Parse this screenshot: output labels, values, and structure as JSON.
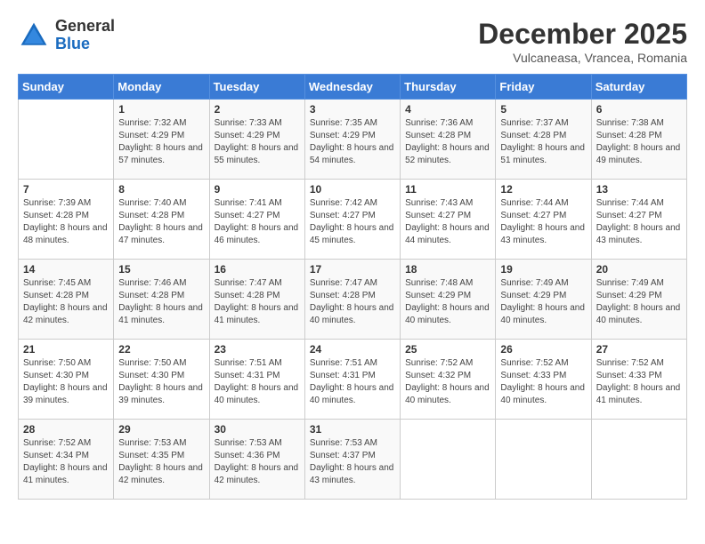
{
  "logo": {
    "general": "General",
    "blue": "Blue"
  },
  "title": "December 2025",
  "subtitle": "Vulcaneasa, Vrancea, Romania",
  "days_of_week": [
    "Sunday",
    "Monday",
    "Tuesday",
    "Wednesday",
    "Thursday",
    "Friday",
    "Saturday"
  ],
  "weeks": [
    [
      {
        "day": "",
        "sunrise": "",
        "sunset": "",
        "daylight": ""
      },
      {
        "day": "1",
        "sunrise": "Sunrise: 7:32 AM",
        "sunset": "Sunset: 4:29 PM",
        "daylight": "Daylight: 8 hours and 57 minutes."
      },
      {
        "day": "2",
        "sunrise": "Sunrise: 7:33 AM",
        "sunset": "Sunset: 4:29 PM",
        "daylight": "Daylight: 8 hours and 55 minutes."
      },
      {
        "day": "3",
        "sunrise": "Sunrise: 7:35 AM",
        "sunset": "Sunset: 4:29 PM",
        "daylight": "Daylight: 8 hours and 54 minutes."
      },
      {
        "day": "4",
        "sunrise": "Sunrise: 7:36 AM",
        "sunset": "Sunset: 4:28 PM",
        "daylight": "Daylight: 8 hours and 52 minutes."
      },
      {
        "day": "5",
        "sunrise": "Sunrise: 7:37 AM",
        "sunset": "Sunset: 4:28 PM",
        "daylight": "Daylight: 8 hours and 51 minutes."
      },
      {
        "day": "6",
        "sunrise": "Sunrise: 7:38 AM",
        "sunset": "Sunset: 4:28 PM",
        "daylight": "Daylight: 8 hours and 49 minutes."
      }
    ],
    [
      {
        "day": "7",
        "sunrise": "Sunrise: 7:39 AM",
        "sunset": "Sunset: 4:28 PM",
        "daylight": "Daylight: 8 hours and 48 minutes."
      },
      {
        "day": "8",
        "sunrise": "Sunrise: 7:40 AM",
        "sunset": "Sunset: 4:28 PM",
        "daylight": "Daylight: 8 hours and 47 minutes."
      },
      {
        "day": "9",
        "sunrise": "Sunrise: 7:41 AM",
        "sunset": "Sunset: 4:27 PM",
        "daylight": "Daylight: 8 hours and 46 minutes."
      },
      {
        "day": "10",
        "sunrise": "Sunrise: 7:42 AM",
        "sunset": "Sunset: 4:27 PM",
        "daylight": "Daylight: 8 hours and 45 minutes."
      },
      {
        "day": "11",
        "sunrise": "Sunrise: 7:43 AM",
        "sunset": "Sunset: 4:27 PM",
        "daylight": "Daylight: 8 hours and 44 minutes."
      },
      {
        "day": "12",
        "sunrise": "Sunrise: 7:44 AM",
        "sunset": "Sunset: 4:27 PM",
        "daylight": "Daylight: 8 hours and 43 minutes."
      },
      {
        "day": "13",
        "sunrise": "Sunrise: 7:44 AM",
        "sunset": "Sunset: 4:27 PM",
        "daylight": "Daylight: 8 hours and 43 minutes."
      }
    ],
    [
      {
        "day": "14",
        "sunrise": "Sunrise: 7:45 AM",
        "sunset": "Sunset: 4:28 PM",
        "daylight": "Daylight: 8 hours and 42 minutes."
      },
      {
        "day": "15",
        "sunrise": "Sunrise: 7:46 AM",
        "sunset": "Sunset: 4:28 PM",
        "daylight": "Daylight: 8 hours and 41 minutes."
      },
      {
        "day": "16",
        "sunrise": "Sunrise: 7:47 AM",
        "sunset": "Sunset: 4:28 PM",
        "daylight": "Daylight: 8 hours and 41 minutes."
      },
      {
        "day": "17",
        "sunrise": "Sunrise: 7:47 AM",
        "sunset": "Sunset: 4:28 PM",
        "daylight": "Daylight: 8 hours and 40 minutes."
      },
      {
        "day": "18",
        "sunrise": "Sunrise: 7:48 AM",
        "sunset": "Sunset: 4:29 PM",
        "daylight": "Daylight: 8 hours and 40 minutes."
      },
      {
        "day": "19",
        "sunrise": "Sunrise: 7:49 AM",
        "sunset": "Sunset: 4:29 PM",
        "daylight": "Daylight: 8 hours and 40 minutes."
      },
      {
        "day": "20",
        "sunrise": "Sunrise: 7:49 AM",
        "sunset": "Sunset: 4:29 PM",
        "daylight": "Daylight: 8 hours and 40 minutes."
      }
    ],
    [
      {
        "day": "21",
        "sunrise": "Sunrise: 7:50 AM",
        "sunset": "Sunset: 4:30 PM",
        "daylight": "Daylight: 8 hours and 39 minutes."
      },
      {
        "day": "22",
        "sunrise": "Sunrise: 7:50 AM",
        "sunset": "Sunset: 4:30 PM",
        "daylight": "Daylight: 8 hours and 39 minutes."
      },
      {
        "day": "23",
        "sunrise": "Sunrise: 7:51 AM",
        "sunset": "Sunset: 4:31 PM",
        "daylight": "Daylight: 8 hours and 40 minutes."
      },
      {
        "day": "24",
        "sunrise": "Sunrise: 7:51 AM",
        "sunset": "Sunset: 4:31 PM",
        "daylight": "Daylight: 8 hours and 40 minutes."
      },
      {
        "day": "25",
        "sunrise": "Sunrise: 7:52 AM",
        "sunset": "Sunset: 4:32 PM",
        "daylight": "Daylight: 8 hours and 40 minutes."
      },
      {
        "day": "26",
        "sunrise": "Sunrise: 7:52 AM",
        "sunset": "Sunset: 4:33 PM",
        "daylight": "Daylight: 8 hours and 40 minutes."
      },
      {
        "day": "27",
        "sunrise": "Sunrise: 7:52 AM",
        "sunset": "Sunset: 4:33 PM",
        "daylight": "Daylight: 8 hours and 41 minutes."
      }
    ],
    [
      {
        "day": "28",
        "sunrise": "Sunrise: 7:52 AM",
        "sunset": "Sunset: 4:34 PM",
        "daylight": "Daylight: 8 hours and 41 minutes."
      },
      {
        "day": "29",
        "sunrise": "Sunrise: 7:53 AM",
        "sunset": "Sunset: 4:35 PM",
        "daylight": "Daylight: 8 hours and 42 minutes."
      },
      {
        "day": "30",
        "sunrise": "Sunrise: 7:53 AM",
        "sunset": "Sunset: 4:36 PM",
        "daylight": "Daylight: 8 hours and 42 minutes."
      },
      {
        "day": "31",
        "sunrise": "Sunrise: 7:53 AM",
        "sunset": "Sunset: 4:37 PM",
        "daylight": "Daylight: 8 hours and 43 minutes."
      },
      {
        "day": "",
        "sunrise": "",
        "sunset": "",
        "daylight": ""
      },
      {
        "day": "",
        "sunrise": "",
        "sunset": "",
        "daylight": ""
      },
      {
        "day": "",
        "sunrise": "",
        "sunset": "",
        "daylight": ""
      }
    ]
  ]
}
